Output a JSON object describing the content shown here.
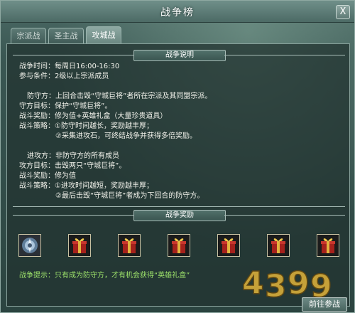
{
  "window": {
    "title": "战争榜",
    "close_label": "X"
  },
  "tabs": [
    {
      "label": "宗派战",
      "active": false
    },
    {
      "label": "圣主战",
      "active": false
    },
    {
      "label": "攻城战",
      "active": true
    }
  ],
  "description": {
    "heading": "战争说明",
    "lines": [
      "战争时间：每周日16:00-16:30",
      "参与条件：2级以上宗派成员",
      "防守方：上回合击毁“守城巨将”者所在宗派及其同盟宗派。",
      "守方目标：保护“守城巨将”。",
      "战斗奖励：修为值+英雄礼盒（大量珍贵道具）",
      "战斗策略：①防守时间越长，奖励越丰厚；",
      "②采集进攻石，可终结战争并获得多倍奖励。",
      "进攻方：非防守方的所有成员",
      "攻方目标：击毁两只“守城巨将”。",
      "战斗奖励：修为值",
      "战斗策略：①进攻时间越短，奖励越丰厚；",
      "②最后击毁“守城巨将”者成为下回合的防守方。"
    ]
  },
  "rewards": {
    "heading": "战争奖励",
    "items": [
      {
        "icon": "cultivation-orb-icon"
      },
      {
        "icon": "hero-gift-box-icon"
      },
      {
        "icon": "hero-gift-box-icon"
      },
      {
        "icon": "hero-gift-box-icon"
      },
      {
        "icon": "hero-gift-box-icon"
      },
      {
        "icon": "hero-gift-box-icon"
      },
      {
        "icon": "hero-gift-box-icon"
      }
    ]
  },
  "tip": "战争提示：只有成为防守方，才有机会获得“英雄礼盒”",
  "actions": {
    "go_label": "前往参战"
  },
  "watermark": {
    "text": "4399"
  },
  "colors": {
    "tip_text": "#9ee36b",
    "panel_border": "#8aa39d",
    "title_text": "#ffffff"
  }
}
